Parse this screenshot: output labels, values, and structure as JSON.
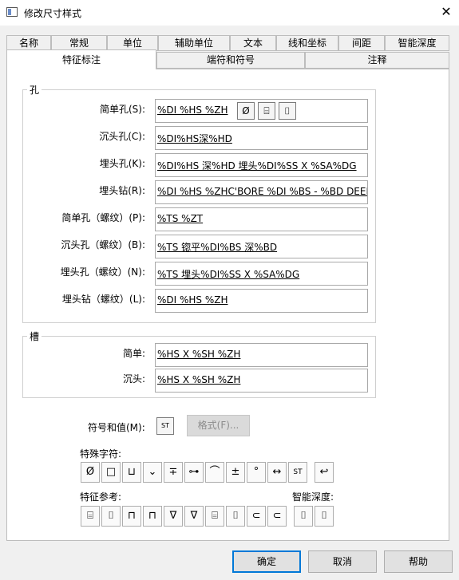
{
  "window": {
    "title": "修改尺寸样式",
    "close_glyph": "✕"
  },
  "tabs_row1": [
    "名称",
    "常规",
    "单位",
    "辅助单位",
    "文本",
    "线和坐标",
    "间距",
    "智能深度"
  ],
  "tabs_row2": [
    "特征标注",
    "端符和符号",
    "注释"
  ],
  "hole_group": {
    "title": "孔",
    "rows": [
      {
        "label": "简单孔(S):",
        "value": "%DI %HS %ZH"
      },
      {
        "label": "沉头孔(C):",
        "value": "%DI%HS深%HD"
      },
      {
        "label": "埋头孔(K):",
        "value": "%DI%HS 深%HD 埋头%DI%SS X %SA%DG"
      },
      {
        "label": "埋头钻(R):",
        "value": "%DI %HS %ZHC'BORE %DI %BS - %BD DEEP"
      },
      {
        "label": "简单孔（螺纹）(P):",
        "value": "%TS %ZT"
      },
      {
        "label": "沉头孔（螺纹）(B):",
        "value": "%TS 锪平%DI%BS 深%BD"
      },
      {
        "label": "埋头孔（螺纹）(N):",
        "value": "%TS 埋头%DI%SS X %SA%DG"
      },
      {
        "label": "埋头钻（螺纹）(L):",
        "value": "%DI %HS %ZH"
      }
    ],
    "inline_buttons": [
      "Ø",
      "⌸",
      "⌷"
    ]
  },
  "slot_group": {
    "title": "槽",
    "rows": [
      {
        "label": "简单:",
        "value": "%HS X %SH %ZH"
      },
      {
        "label": "沉头:",
        "value": "%HS X %SH %ZH"
      }
    ]
  },
  "symbols": {
    "label": "符号和值(M):",
    "sym_button": "ST",
    "format_button": "格式(F)..."
  },
  "special_chars": {
    "label": "特殊字符:",
    "buttons": [
      "Ø",
      "□",
      "⊔",
      "⌄",
      "∓",
      "⊶",
      "⌒",
      "±",
      "°",
      "↔",
      "ST",
      "↩"
    ]
  },
  "feature_ref": {
    "label": "特征参考:",
    "smart_label": "智能深度:",
    "buttons": [
      "⌸",
      "⌷",
      "⊓",
      "⊓",
      "∇",
      "∇",
      "⌸",
      "⌷",
      "⊂",
      "⊂"
    ],
    "smart_buttons": [
      "⌷",
      "⌷"
    ]
  },
  "footer": {
    "ok": "确定",
    "cancel": "取消",
    "help": "帮助"
  }
}
